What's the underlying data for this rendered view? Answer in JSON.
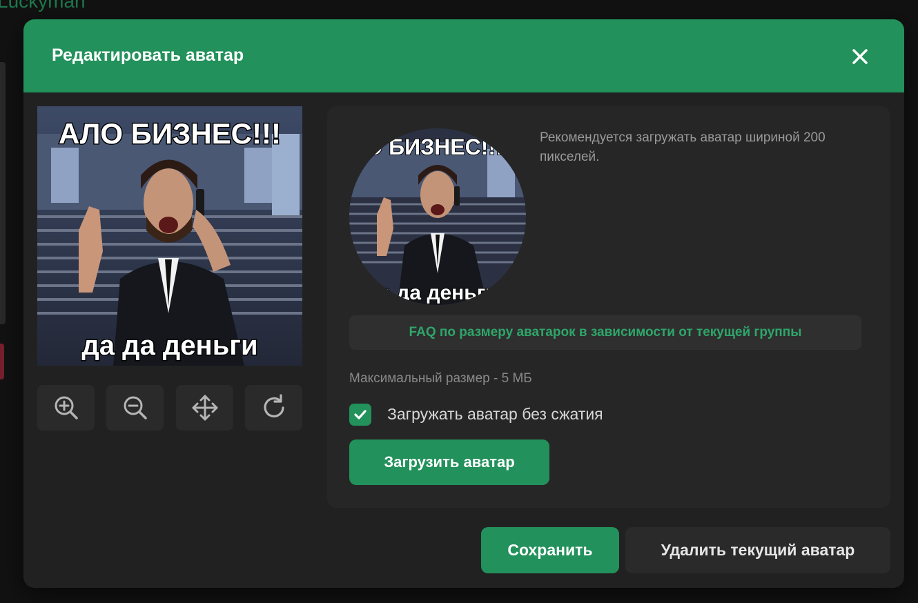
{
  "background": {
    "username": "Luckyman"
  },
  "modal": {
    "title": "Редактировать аватар",
    "close_icon": "close-icon"
  },
  "image": {
    "top_caption": "АЛО БИЗНЕС!!!",
    "bottom_caption": "да да деньги"
  },
  "tools": [
    {
      "icon": "zoom-in-icon"
    },
    {
      "icon": "zoom-out-icon"
    },
    {
      "icon": "move-icon"
    },
    {
      "icon": "rotate-icon"
    }
  ],
  "panel": {
    "recommend": "Рекомендуется загружать аватар шириной 200 пикселей.",
    "faq_label": "FAQ по размеру аватарок в зависимости от текущей группы",
    "max_size": "Максимальный размер - 5 МБ",
    "checkbox_label": "Загружать аватар без сжатия",
    "checkbox_checked": true,
    "upload_label": "Загрузить аватар"
  },
  "footer": {
    "save_label": "Сохранить",
    "delete_label": "Удалить текущий аватар"
  },
  "colors": {
    "accent": "#22915b",
    "accent_text": "#2ea66a",
    "modal_bg": "#212121",
    "panel_bg": "#262626"
  }
}
